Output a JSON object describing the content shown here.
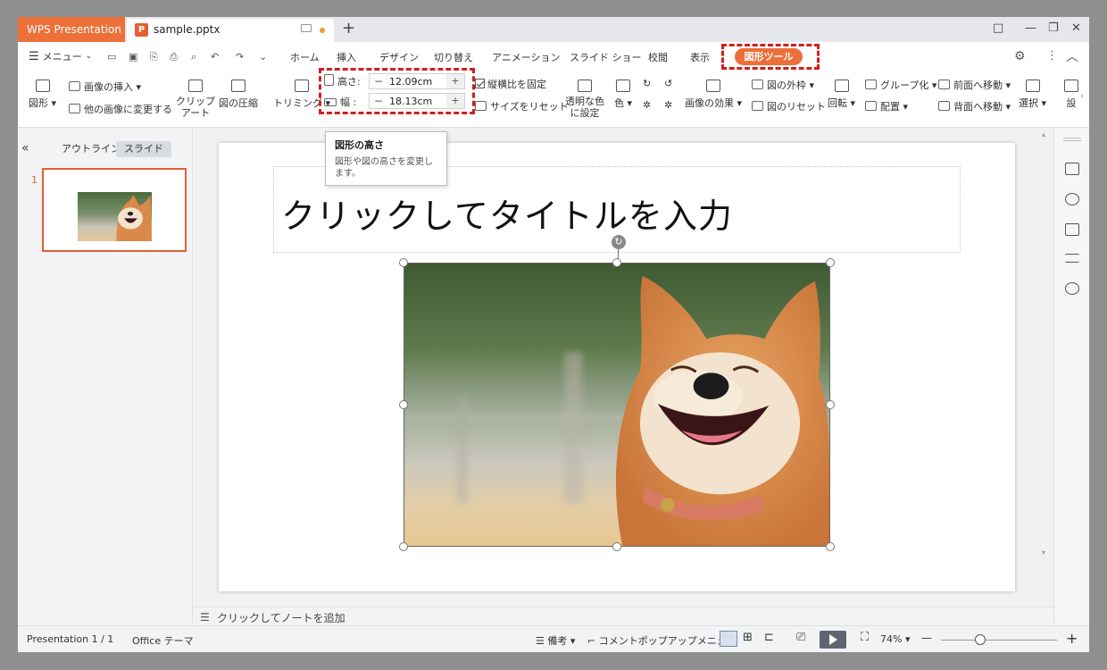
{
  "titlebar": {
    "app_tab": "WPS Presentation",
    "file_tab": "sample.pptx",
    "new_tab": "+",
    "window_controls": [
      "□",
      "—",
      "❐",
      "✕"
    ]
  },
  "menubar": {
    "menu_label": "メニュー",
    "tabs": [
      "ホーム",
      "挿入",
      "デザイン",
      "切り替え",
      "アニメーション",
      "スライド ショー",
      "校閲",
      "表示"
    ],
    "active_tab": "図形ツール"
  },
  "ribbon": {
    "shape": "図形",
    "insert_image": "画像の挿入",
    "change_image": "他の画像に変更する",
    "clipart_line1": "クリップ",
    "clipart_line2": "アート",
    "compress": "図の圧縮",
    "trimming": "トリミング",
    "height_label": "高さ:",
    "height_value": "12.09cm",
    "width_label": "幅 :",
    "width_value": "18.13cm",
    "lock_aspect": "縦横比を固定",
    "reset_size": "サイズをリセット",
    "transparent_line1": "透明な色",
    "transparent_line2": "に設定",
    "color": "色",
    "image_effect": "画像の効果",
    "image_border": "図の外枠",
    "reset_image": "図のリセット",
    "rotate": "回転",
    "group": "グループ化",
    "arrange": "配置",
    "bring_forward": "前面へ移動",
    "send_backward": "背面へ移動",
    "select": "選択",
    "settings_partial": "設"
  },
  "tooltip": {
    "title": "図形の高さ",
    "body": "図形や図の高さを変更します。"
  },
  "left_panel": {
    "outline_tab": "アウトライン",
    "slide_tab": "スライド",
    "slide_number": "1"
  },
  "slide": {
    "title_placeholder": "クリックしてタイトルを入力"
  },
  "notes": {
    "placeholder": "クリックしてノートを追加"
  },
  "statusbar": {
    "presentation_count": "Presentation 1 / 1",
    "theme": "Office テーマ",
    "notes_btn": "備考",
    "comment_popup": "コメントポップアップメニュー",
    "zoom": "74%",
    "zoom_minus": "—",
    "zoom_plus": "+"
  },
  "colors": {
    "accent": "#ec7038",
    "highlight_dash": "#d01f1f"
  }
}
